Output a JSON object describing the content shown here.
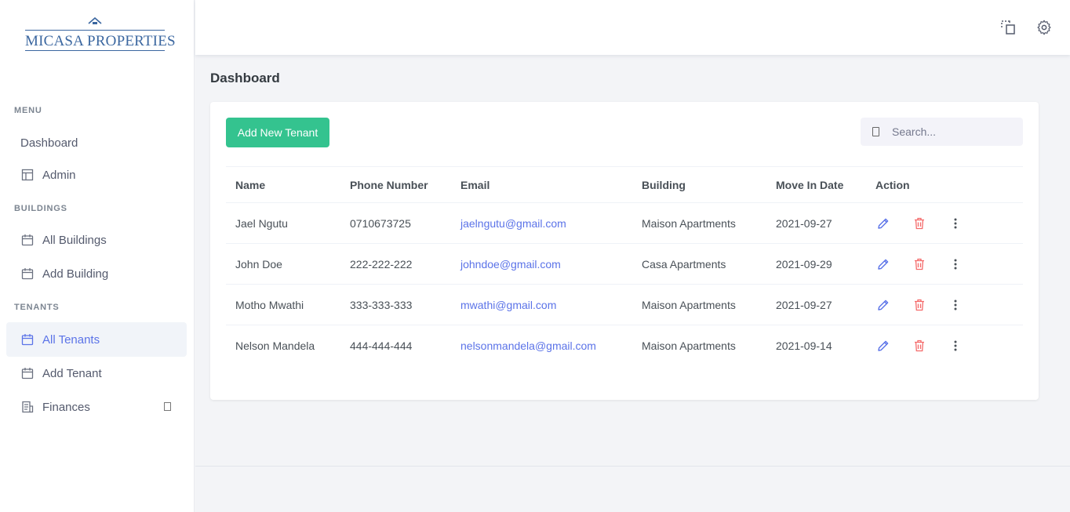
{
  "brand": {
    "logo_text": "MICASA PROPERTIES"
  },
  "sidebar": {
    "menu_title": "MENU",
    "buildings_title": "BUILDINGS",
    "tenants_title": "TENANTS",
    "items": [
      {
        "label": "Dashboard",
        "icon": "none"
      },
      {
        "label": "Admin",
        "icon": "layout-icon"
      },
      {
        "label": "All Buildings",
        "icon": "calendar-icon"
      },
      {
        "label": "Add Building",
        "icon": "calendar-icon"
      },
      {
        "label": "All Tenants",
        "icon": "calendar-icon",
        "active": true
      },
      {
        "label": "Add Tenant",
        "icon": "calendar-icon"
      },
      {
        "label": "Finances",
        "icon": "receipt-icon"
      }
    ]
  },
  "page": {
    "title": "Dashboard"
  },
  "toolbar": {
    "add_label": "Add New Tenant"
  },
  "search": {
    "placeholder": "Search..."
  },
  "table": {
    "headers": [
      "Name",
      "Phone Number",
      "Email",
      "Building",
      "Move In Date",
      "Action"
    ],
    "rows": [
      {
        "name": "Jael Ngutu",
        "phone": "0710673725",
        "email": "jaelngutu@gmail.com",
        "building": "Maison Apartments",
        "date": "2021-09-27"
      },
      {
        "name": "John Doe",
        "phone": "222-222-222",
        "email": "johndoe@gmail.com",
        "building": "Casa Apartments",
        "date": "2021-09-29"
      },
      {
        "name": "Motho Mwathi",
        "phone": "333-333-333",
        "email": "mwathi@gmail.com",
        "building": "Maison Apartments",
        "date": "2021-09-27"
      },
      {
        "name": "Nelson Mandela",
        "phone": "444-444-444",
        "email": "nelsonmandela@gmail.com",
        "building": "Maison Apartments",
        "date": "2021-09-14"
      }
    ]
  },
  "colors": {
    "accent": "#5b73e8",
    "success": "#34c38f",
    "danger": "#f46a6a",
    "logo": "#3b67a0"
  }
}
